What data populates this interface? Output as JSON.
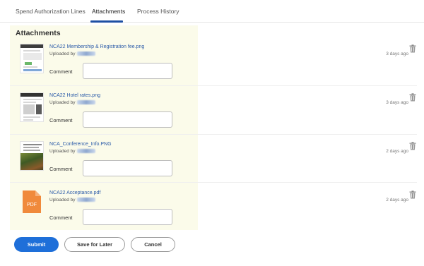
{
  "tabs": [
    {
      "label": "Spend Authorization Lines",
      "active": false
    },
    {
      "label": "Attachments",
      "active": true
    },
    {
      "label": "Process History",
      "active": false
    }
  ],
  "accent_color": "#1e4fa3",
  "section": {
    "title": "Attachments"
  },
  "attachments": [
    {
      "filename": "NCA22 Membership & Registration fee.png",
      "uploaded_by_label": "Uploaded by",
      "time_ago": "3 days ago",
      "comment_label": "Comment",
      "comment_value": "",
      "thumbnail": "screenshot-thumbnail"
    },
    {
      "filename": "NCA22 Hotel rates.png",
      "uploaded_by_label": "Uploaded by",
      "time_ago": "3 days ago",
      "comment_label": "Comment",
      "comment_value": "",
      "thumbnail": "screenshot-thumbnail"
    },
    {
      "filename": "NCA_Conference_Info.PNG",
      "uploaded_by_label": "Uploaded by",
      "time_ago": "2 days ago",
      "comment_label": "Comment",
      "comment_value": "",
      "thumbnail": "photo-thumbnail"
    },
    {
      "filename": "NCA22 Acceptance.pdf",
      "uploaded_by_label": "Uploaded by",
      "time_ago": "2 days ago",
      "comment_label": "Comment",
      "comment_value": "",
      "thumbnail": "pdf-icon",
      "pdf_badge": "PDF"
    }
  ],
  "buttons": {
    "submit": "Submit",
    "save_for_later": "Save for Later",
    "cancel": "Cancel"
  },
  "colors": {
    "primary": "#1e6fd9",
    "link": "#2a5aa8",
    "panel_bg": "#fbfbea",
    "pdf": "#f08a3c"
  }
}
